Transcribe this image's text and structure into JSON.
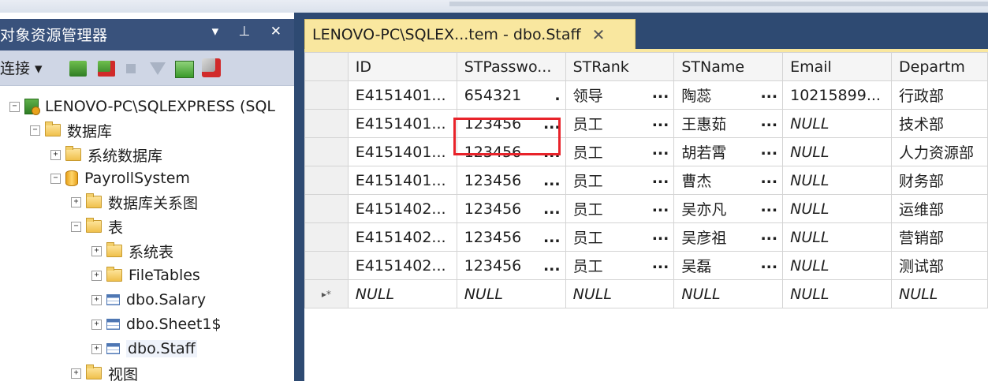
{
  "object_explorer": {
    "title": "对象资源管理器",
    "title_buttons": "▾ ⊥ ✕",
    "toolbar": {
      "connect_label": "连接 ▾"
    },
    "tree": [
      {
        "label": "LENOVO-PC\\SQLEXPRESS (SQL",
        "expander": "−",
        "icon": "server-icon"
      },
      {
        "label": "数据库",
        "expander": "−",
        "icon": "folder-icon"
      },
      {
        "label": "系统数据库",
        "expander": "+",
        "icon": "folder-icon"
      },
      {
        "label": "PayrollSystem",
        "expander": "−",
        "icon": "database-icon"
      },
      {
        "label": "数据库关系图",
        "expander": "+",
        "icon": "folder-icon"
      },
      {
        "label": "表",
        "expander": "−",
        "icon": "folder-icon"
      },
      {
        "label": "系统表",
        "expander": "+",
        "icon": "folder-icon"
      },
      {
        "label": "FileTables",
        "expander": "+",
        "icon": "folder-icon"
      },
      {
        "label": "dbo.Salary",
        "expander": "+",
        "icon": "table-icon"
      },
      {
        "label": "dbo.Sheet1$",
        "expander": "+",
        "icon": "table-icon"
      },
      {
        "label": "dbo.Staff",
        "expander": "+",
        "icon": "table-icon"
      },
      {
        "label": "视图",
        "expander": "+",
        "icon": "folder-icon"
      }
    ]
  },
  "document": {
    "tab_title": "LENOVO-PC\\SQLEX...tem - dbo.Staff",
    "tab_close": "✕",
    "columns": [
      "ID",
      "STPasswo...",
      "STRank",
      "STName",
      "Email",
      "Departm"
    ],
    "rows": [
      [
        "E4151401...",
        "654321",
        "领导",
        "陶蕊",
        "10215899...",
        "行政部"
      ],
      [
        "E4151401...",
        "123456",
        "员工",
        "王惠茹",
        "NULL",
        "技术部"
      ],
      [
        "E4151401...",
        "123456",
        "员工",
        "胡若霄",
        "NULL",
        "人力资源部"
      ],
      [
        "E4151401...",
        "123456",
        "员工",
        "曹杰",
        "NULL",
        "财务部"
      ],
      [
        "E4151402...",
        "123456",
        "员工",
        "吴亦凡",
        "NULL",
        "运维部"
      ],
      [
        "E4151402...",
        "123456",
        "员工",
        "吴彦祖",
        "NULL",
        "营销部"
      ],
      [
        "E4151402...",
        "123456",
        "员工",
        "吴磊",
        "NULL",
        "测试部"
      ]
    ],
    "new_row": [
      "NULL",
      "NULL",
      "NULL",
      "NULL",
      "NULL",
      "NULL"
    ],
    "new_row_marker": "▸*",
    "ellipsis": "..."
  }
}
